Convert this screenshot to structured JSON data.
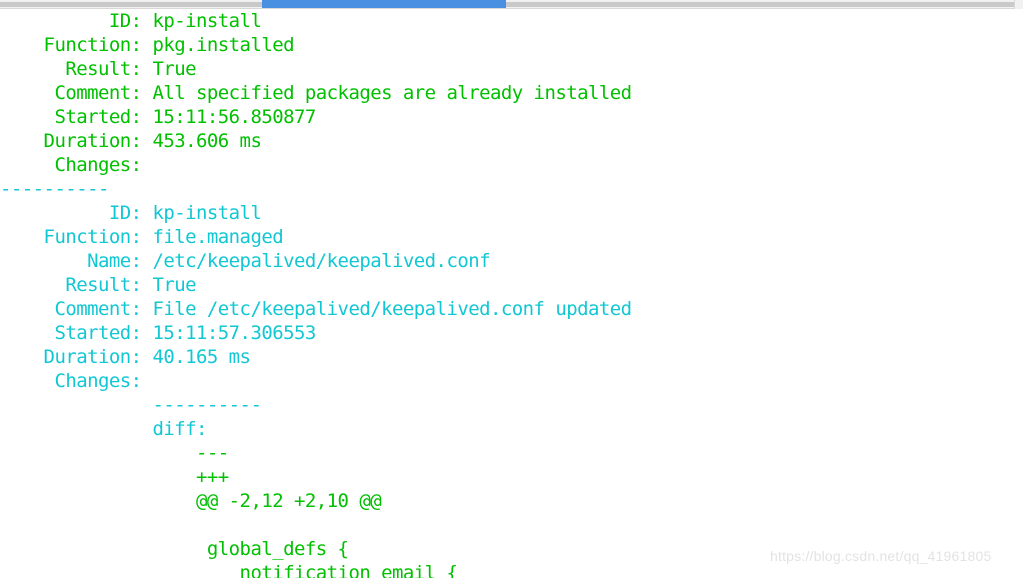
{
  "scrollbar": {
    "orientation": "horizontal",
    "thumb_color": "#4a90e2",
    "track_color": "#c9c9c9"
  },
  "terminal": {
    "colors": {
      "green": "#00c000",
      "cyan": "#12c7d4",
      "background": "#ffffff"
    },
    "lines": [
      {
        "text": "          ID: kp-install",
        "color": "green"
      },
      {
        "text": "    Function: pkg.installed",
        "color": "green"
      },
      {
        "text": "      Result: True",
        "color": "green"
      },
      {
        "text": "     Comment: All specified packages are already installed",
        "color": "green"
      },
      {
        "text": "     Started: 15:11:56.850877",
        "color": "green"
      },
      {
        "text": "    Duration: 453.606 ms",
        "color": "green"
      },
      {
        "text": "     Changes:",
        "color": "green"
      },
      {
        "text": "----------",
        "color": "cyan"
      },
      {
        "text": "          ID: kp-install",
        "color": "cyan"
      },
      {
        "text": "    Function: file.managed",
        "color": "cyan"
      },
      {
        "text": "        Name: /etc/keepalived/keepalived.conf",
        "color": "cyan"
      },
      {
        "text": "      Result: True",
        "color": "cyan"
      },
      {
        "text": "     Comment: File /etc/keepalived/keepalived.conf updated",
        "color": "cyan"
      },
      {
        "text": "     Started: 15:11:57.306553",
        "color": "cyan"
      },
      {
        "text": "    Duration: 40.165 ms",
        "color": "cyan"
      },
      {
        "text": "     Changes:",
        "color": "cyan"
      },
      {
        "text": "              ----------",
        "color": "cyan"
      },
      {
        "text": "              diff:",
        "color": "cyan"
      },
      {
        "text": "                  ---",
        "color": "green"
      },
      {
        "text": "                  +++",
        "color": "green"
      },
      {
        "text": "                  @@ -2,12 +2,10 @@",
        "color": "green"
      },
      {
        "text": "",
        "color": "green"
      },
      {
        "text": "                   global_defs {",
        "color": "green"
      },
      {
        "text": "                      notification_email {",
        "color": "green"
      }
    ]
  },
  "watermark": {
    "text": "https://blog.csdn.net/qq_41961805"
  }
}
